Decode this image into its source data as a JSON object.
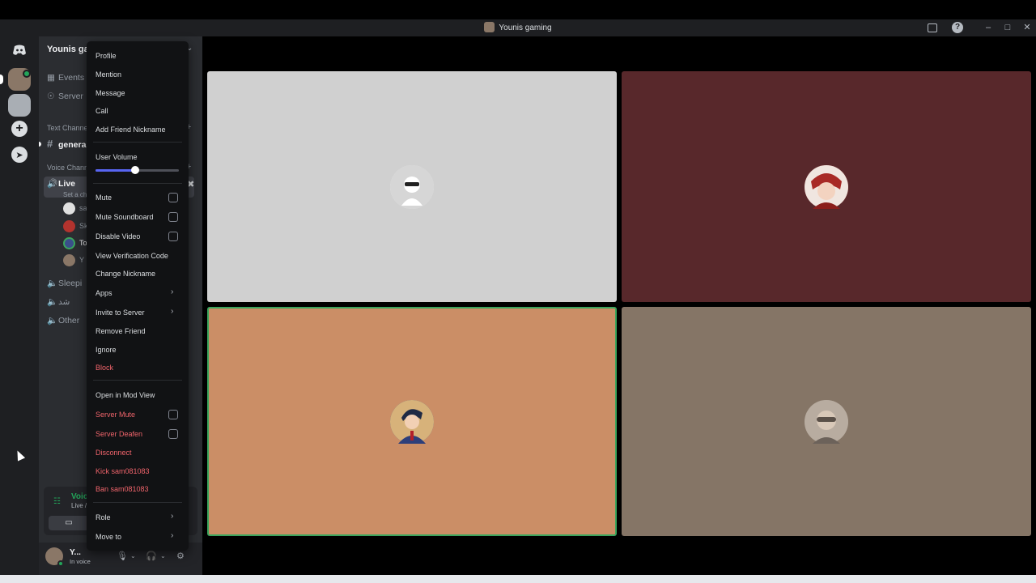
{
  "window": {
    "title": "Younis gaming"
  },
  "sidebar": {
    "server_name": "Younis gam",
    "items": [
      {
        "label": "Events",
        "icon": "calendar-icon"
      },
      {
        "label": "Server",
        "icon": "shield-icon"
      }
    ],
    "text_category": "Text Channe",
    "text_channels": [
      {
        "label": "genera"
      }
    ],
    "voice_category": "Voice Chann",
    "voice_channels": [
      {
        "label": "Live",
        "topic": "Set a cha"
      },
      {
        "label": "Sleepi"
      },
      {
        "label": "شد"
      },
      {
        "label": "Other"
      }
    ],
    "members": [
      {
        "label": "sa",
        "color": "#e0e0e0"
      },
      {
        "label": "Sk",
        "color": "#b3332e"
      },
      {
        "label": "To",
        "color": "#3ba55d"
      },
      {
        "label": "Y",
        "color": "#8a7767"
      }
    ]
  },
  "voice": {
    "title": "Voice Connecte",
    "subtitle": "Live / Younis gaming"
  },
  "user": {
    "name": "Y...",
    "status": "In voice"
  },
  "tiles": [
    {
      "bg": "#d0d0d0",
      "speaking": false
    },
    {
      "bg": "#58282b",
      "speaking": false
    },
    {
      "bg": "#cb8e66",
      "speaking": true
    },
    {
      "bg": "#857566",
      "speaking": false
    }
  ],
  "context_menu": {
    "profile": "Profile",
    "mention": "Mention",
    "message": "Message",
    "call": "Call",
    "add_friend_nickname": "Add Friend Nickname",
    "user_volume": "User Volume",
    "user_volume_level": 0.48,
    "mute": "Mute",
    "mute_soundboard": "Mute Soundboard",
    "disable_video": "Disable Video",
    "view_verification_code": "View Verification Code",
    "change_nickname": "Change Nickname",
    "apps": "Apps",
    "invite_to_server": "Invite to Server",
    "remove_friend": "Remove Friend",
    "ignore": "Ignore",
    "block": "Block",
    "open_in_mod_view": "Open in Mod View",
    "server_mute": "Server Mute",
    "server_deafen": "Server Deafen",
    "disconnect": "Disconnect",
    "kick": "Kick sam081083",
    "ban": "Ban sam081083",
    "role": "Role",
    "move_to": "Move to"
  },
  "colors": {
    "accent": "#5865f2",
    "danger": "#f0646b",
    "online": "#23a55a"
  }
}
